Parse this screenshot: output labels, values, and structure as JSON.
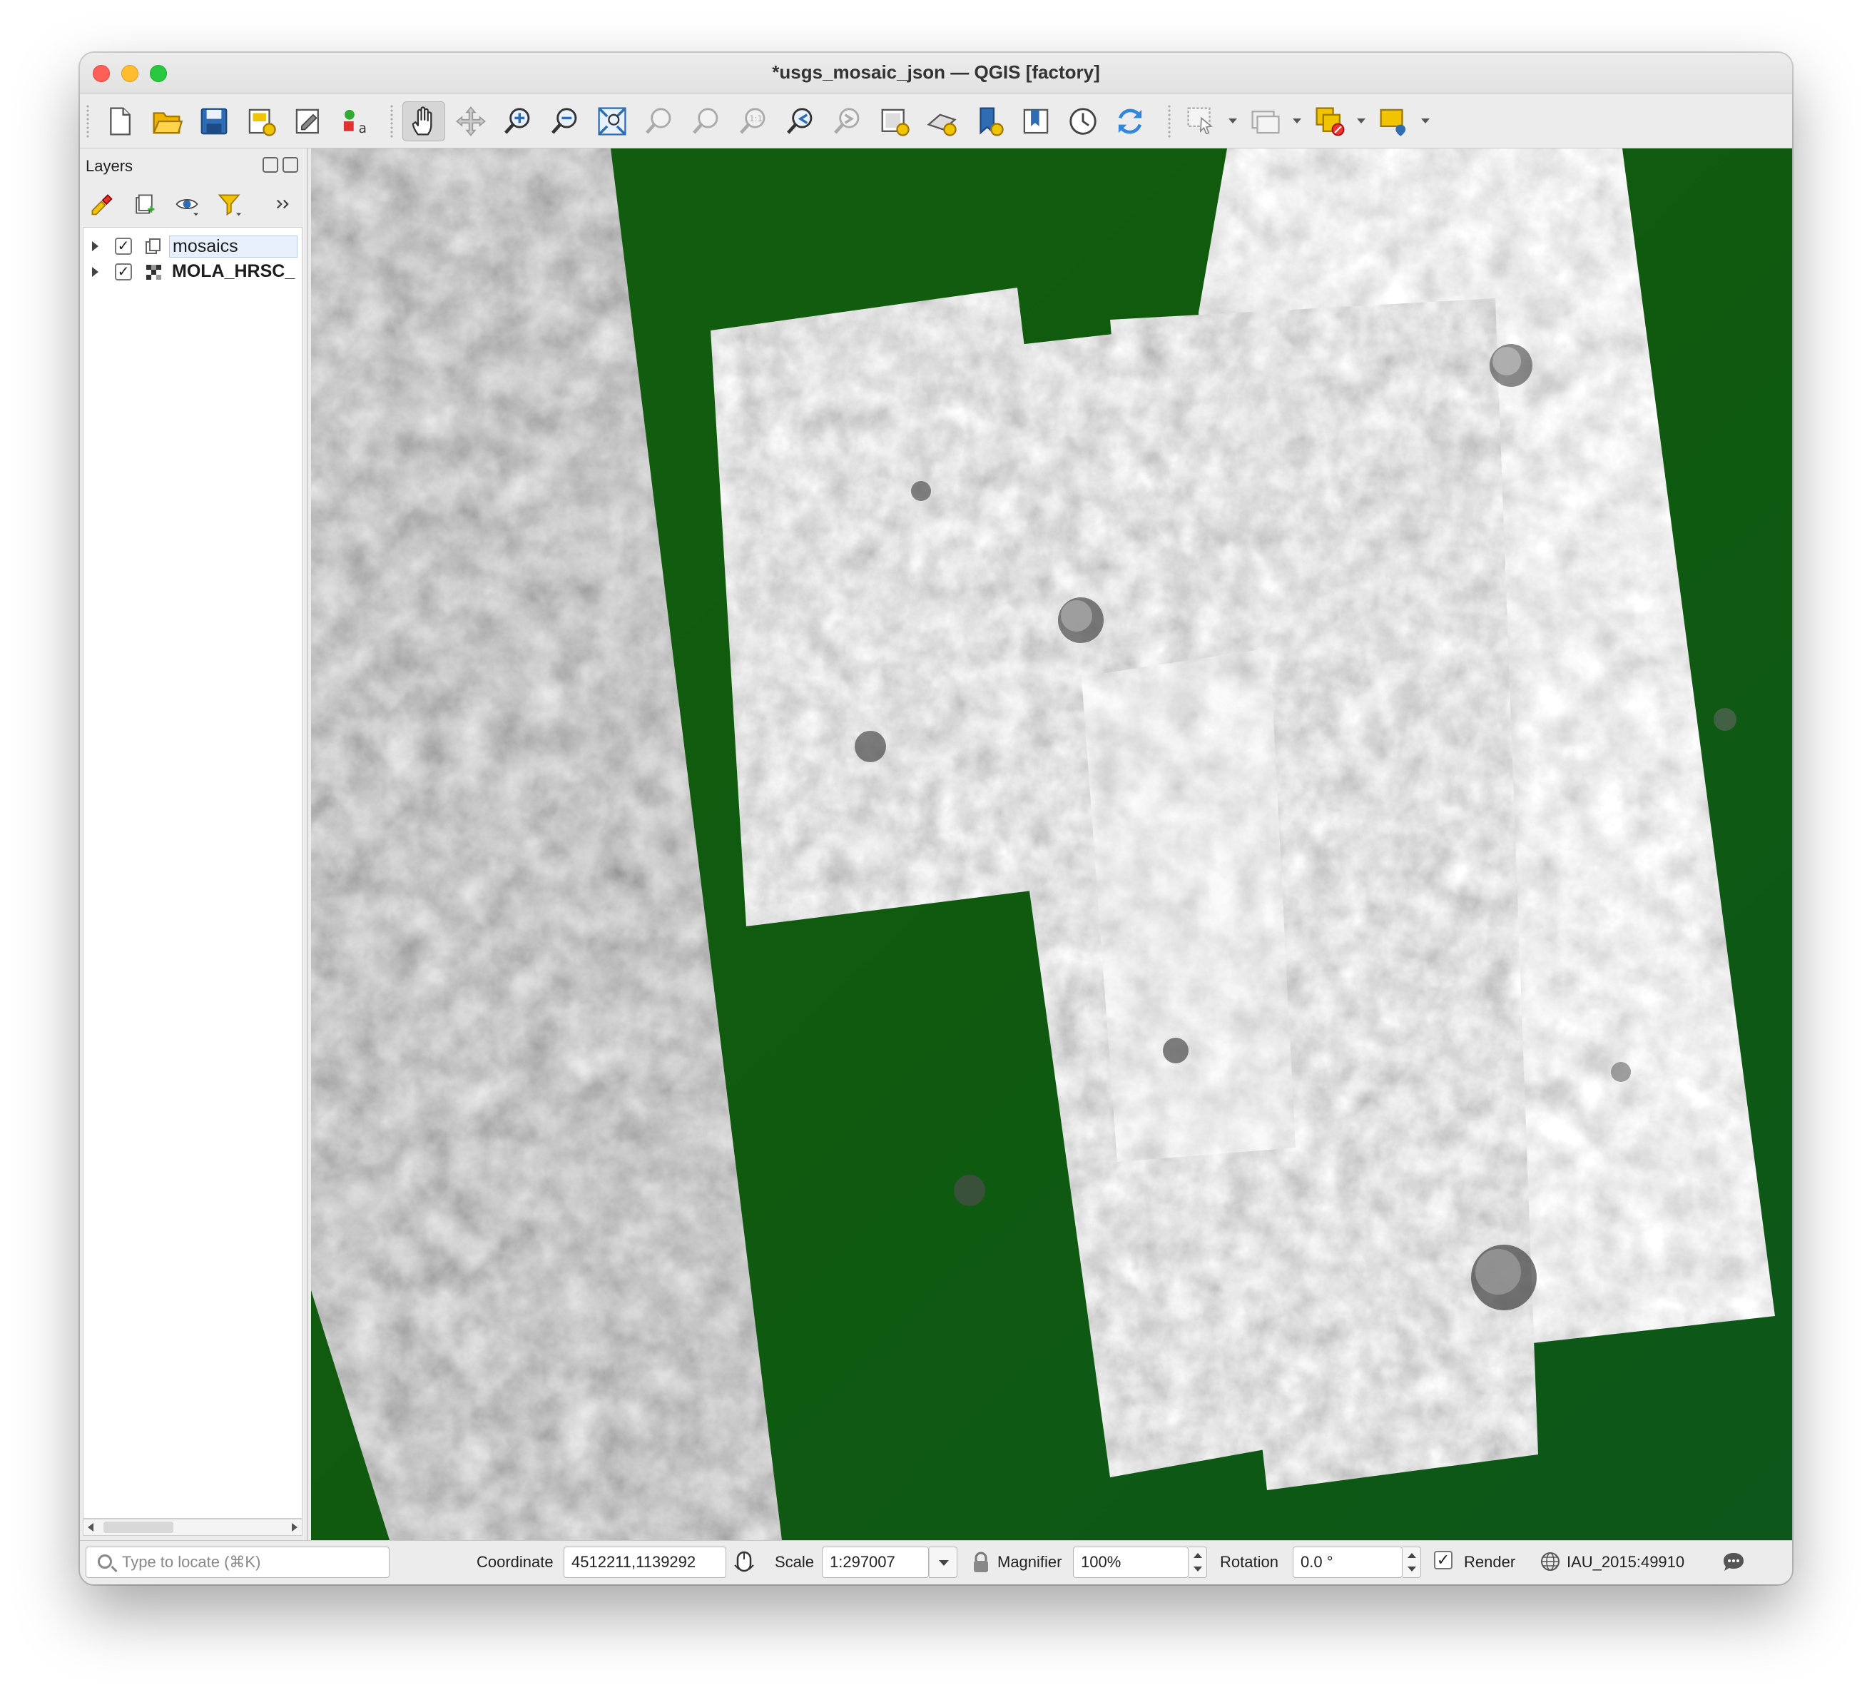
{
  "window": {
    "title": "*usgs_mosaic_json — QGIS [factory]"
  },
  "toolbar": {
    "icons": [
      "new-project-icon",
      "open-project-icon",
      "save-project-icon",
      "new-print-layout-icon",
      "layout-manager-icon",
      "style-manager-icon",
      "pan-map-icon",
      "pan-to-selection-icon",
      "zoom-in-icon",
      "zoom-out-icon",
      "zoom-full-icon",
      "zoom-to-selection-icon",
      "zoom-to-layer-icon",
      "zoom-native-resolution-icon",
      "zoom-last-icon",
      "zoom-next-icon",
      "new-map-view-icon",
      "new-3d-map-view-icon",
      "new-spatial-bookmark-icon",
      "show-bookmarks-icon",
      "temporal-controller-icon",
      "refresh-icon",
      "select-features-icon",
      "open-attribute-table-icon",
      "deselect-all-icon",
      "label-icon"
    ]
  },
  "layers_panel": {
    "title": "Layers",
    "tools": [
      "open-layer-styling-icon",
      "add-group-icon",
      "manage-map-themes-icon",
      "filter-legend-icon",
      "more-tools-icon"
    ],
    "items": [
      {
        "label": "mosaics",
        "checked": true,
        "icon": "layer-group-icon",
        "selected": true,
        "bold": false
      },
      {
        "label": "MOLA_HRSC_",
        "checked": true,
        "icon": "raster-layer-icon",
        "selected": false,
        "bold": true
      }
    ]
  },
  "statusbar": {
    "locate_placeholder": "Type to locate (⌘K)",
    "coordinate_label": "Coordinate",
    "coordinate_value": "4512211,1139292",
    "scale_label": "Scale",
    "scale_value": "1:297007",
    "magnifier_label": "Magnifier",
    "magnifier_value": "100%",
    "rotation_label": "Rotation",
    "rotation_value": "0.0 °",
    "render_label": "Render",
    "render_checked": true,
    "crs_value": "IAU_2015:49910"
  }
}
